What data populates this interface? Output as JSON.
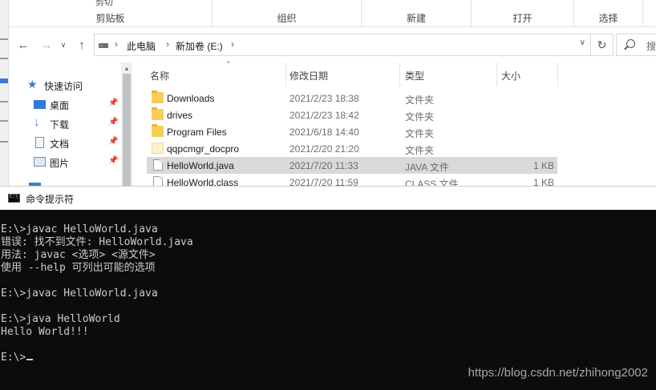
{
  "ribbon": {
    "top_cut_left": "剪切",
    "group_clipboard": "剪贴板",
    "group_organize": "组织",
    "group_new": "新建",
    "group_open": "打开",
    "group_select": "选择"
  },
  "nav": {
    "breadcrumb": [
      "此电脑",
      "新加卷 (E:)"
    ],
    "search_placeholder": "搜"
  },
  "sidebar": {
    "items": [
      {
        "label": "快速访问",
        "icon": "star-icon"
      },
      {
        "label": "桌面",
        "icon": "desktop-icon",
        "pinned": true
      },
      {
        "label": "下载",
        "icon": "download-icon",
        "pinned": true
      },
      {
        "label": "文档",
        "icon": "document-icon",
        "pinned": true
      },
      {
        "label": "图片",
        "icon": "picture-icon",
        "pinned": true
      }
    ]
  },
  "files": {
    "columns": [
      "名称",
      "修改日期",
      "类型",
      "大小"
    ],
    "rows": [
      {
        "name": "Downloads",
        "date": "2021/2/23 18:38",
        "type": "文件夹",
        "size": "",
        "icon": "folder-icon"
      },
      {
        "name": "drives",
        "date": "2021/2/23 18:42",
        "type": "文件夹",
        "size": "",
        "icon": "folder-icon"
      },
      {
        "name": "Program Files",
        "date": "2021/6/18 14:40",
        "type": "文件夹",
        "size": "",
        "icon": "folder-icon"
      },
      {
        "name": "qqpcmgr_docpro",
        "date": "2021/2/20 21:20",
        "type": "文件夹",
        "size": "",
        "icon": "folder-light-icon"
      },
      {
        "name": "HelloWorld.java",
        "date": "2021/7/20 11:33",
        "type": "JAVA 文件",
        "size": "1 KB",
        "icon": "file-icon",
        "selected": true
      },
      {
        "name": "HelloWorld.class",
        "date": "2021/7/20 11:59",
        "type": "CLASS 文件",
        "size": "1 KB",
        "icon": "file-icon"
      }
    ]
  },
  "cmd": {
    "title": "命令提示符",
    "lines": [
      "E:\\>javac HelloWorld.java",
      "错误: 找不到文件: HelloWorld.java",
      "用法: javac <选项> <源文件>",
      "使用 --help 可列出可能的选项",
      "",
      "E:\\>javac HelloWorld.java",
      "",
      "E:\\>java HelloWorld",
      "Hello World!!!",
      "",
      "E:\\>"
    ]
  },
  "watermark": "https://blog.csdn.net/zhihong2002"
}
